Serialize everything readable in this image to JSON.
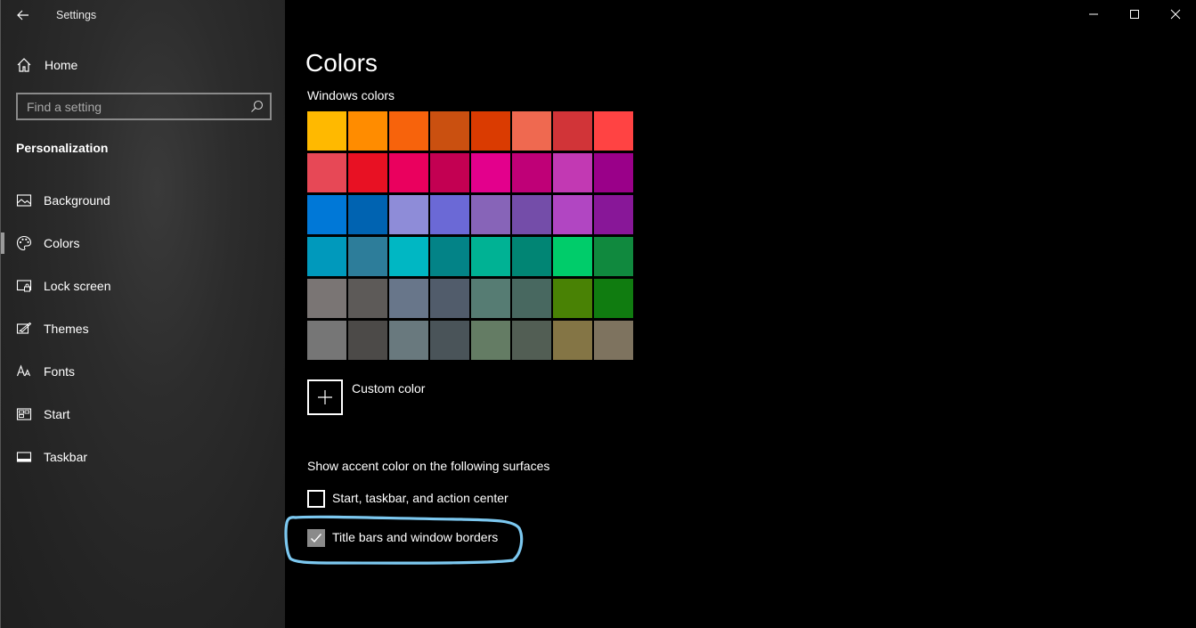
{
  "window": {
    "title": "Settings"
  },
  "sidebar": {
    "home_label": "Home",
    "search_placeholder": "Find a setting",
    "section_title": "Personalization",
    "items": [
      {
        "label": "Background",
        "icon": "image-icon",
        "selected": false
      },
      {
        "label": "Colors",
        "icon": "palette-icon",
        "selected": true
      },
      {
        "label": "Lock screen",
        "icon": "lock-screen-icon",
        "selected": false
      },
      {
        "label": "Themes",
        "icon": "themes-icon",
        "selected": false
      },
      {
        "label": "Fonts",
        "icon": "fonts-icon",
        "selected": false
      },
      {
        "label": "Start",
        "icon": "start-icon",
        "selected": false
      },
      {
        "label": "Taskbar",
        "icon": "taskbar-icon",
        "selected": false
      }
    ]
  },
  "main": {
    "title": "Colors",
    "windows_colors_label": "Windows colors",
    "swatches": [
      [
        "#FFB900",
        "#FF8C00",
        "#F7630C",
        "#CA5010",
        "#DA3B01",
        "#EF6950",
        "#D13438",
        "#FF4343"
      ],
      [
        "#E74856",
        "#E81123",
        "#EA005E",
        "#C30052",
        "#E3008C",
        "#BF0077",
        "#C239B3",
        "#9A0089"
      ],
      [
        "#0078D7",
        "#0063B1",
        "#8E8CD8",
        "#6B69D6",
        "#8764B8",
        "#744DA9",
        "#B146C2",
        "#881798"
      ],
      [
        "#0099BC",
        "#2D7D9A",
        "#00B7C3",
        "#038387",
        "#00B294",
        "#018574",
        "#00CC6A",
        "#10893E"
      ],
      [
        "#7A7574",
        "#5D5A58",
        "#68768A",
        "#515C6B",
        "#567C73",
        "#486860",
        "#498205",
        "#107C10"
      ],
      [
        "#767676",
        "#4C4A48",
        "#69797E",
        "#4A5459",
        "#647C64",
        "#525E54",
        "#847545",
        "#7E735F"
      ]
    ],
    "custom_color_label": "Custom color",
    "accent_surfaces_label": "Show accent color on the following surfaces",
    "checkboxes": [
      {
        "label": "Start, taskbar, and action center",
        "checked": false
      },
      {
        "label": "Title bars and window borders",
        "checked": true
      }
    ]
  },
  "colors": {
    "highlight_stroke": "#7cc8f0",
    "checked_fill": "#8a8a8a"
  }
}
